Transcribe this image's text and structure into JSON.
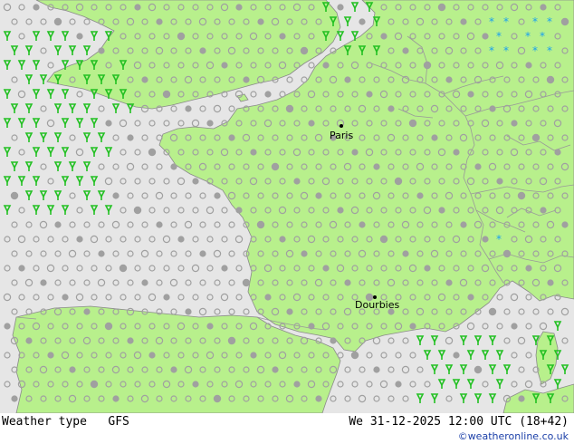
{
  "footer": {
    "left_label": "Weather type",
    "model": "GFS",
    "valid_time": "We 31-12-2025 12:00 UTC (18+42)",
    "credit": "©weatheronline.co.uk"
  },
  "cities": [
    {
      "name": "Paris"
    },
    {
      "name": "Dourbies"
    }
  ],
  "colors": {
    "land": "#b8f08c",
    "sea": "#e6e6e6",
    "border": "#999999",
    "rain": "#22c022",
    "snow": "#1aa0f0",
    "cloud": "#a0a0a0",
    "city_dot": "#000000"
  },
  "legend": {
    "rain": "rain-shower-symbol",
    "snow": "snow-symbol",
    "cloud": "cloud-symbol"
  }
}
